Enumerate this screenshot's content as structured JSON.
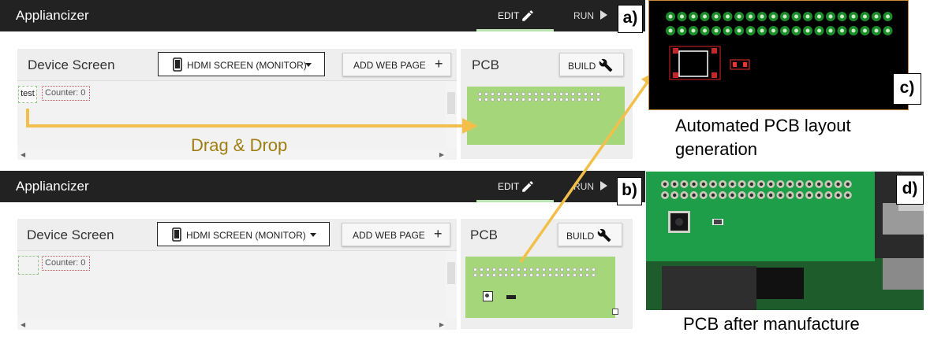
{
  "app": {
    "title": "Appliancizer",
    "edit_label": "EDIT",
    "run_label": "RUN"
  },
  "device_card": {
    "title": "Device Screen",
    "screen_select": "HDMI SCREEN (MONITOR)",
    "add_web_page": "ADD WEB PAGE"
  },
  "pcb_card": {
    "title": "PCB",
    "build_label": "BUILD"
  },
  "elements": {
    "test_label": "test",
    "counter_label": "Counter: 0"
  },
  "annotations": {
    "drag_drop": "Drag & Drop",
    "badge_a": "a)",
    "badge_b": "b)",
    "badge_c": "c)",
    "badge_d": "d)",
    "caption_c_line1": "Automated PCB layout",
    "caption_c_line2": "generation",
    "caption_d": "PCB after manufacture"
  },
  "colors": {
    "appbar": "#222222",
    "accent_edit": "#b9e3b0",
    "pcb_green": "#a6d67a",
    "arrow": "#f2c04a",
    "drag_text": "#a07d10",
    "pcb_board_black": "#000000",
    "copper_pad": "#1a8c2a"
  },
  "icons": {
    "edit": "pencil-icon",
    "run": "play-icon",
    "build": "wrench-icon",
    "screen": "monitor-icon",
    "dropdown": "caret-down-icon",
    "add": "plus-icon"
  }
}
